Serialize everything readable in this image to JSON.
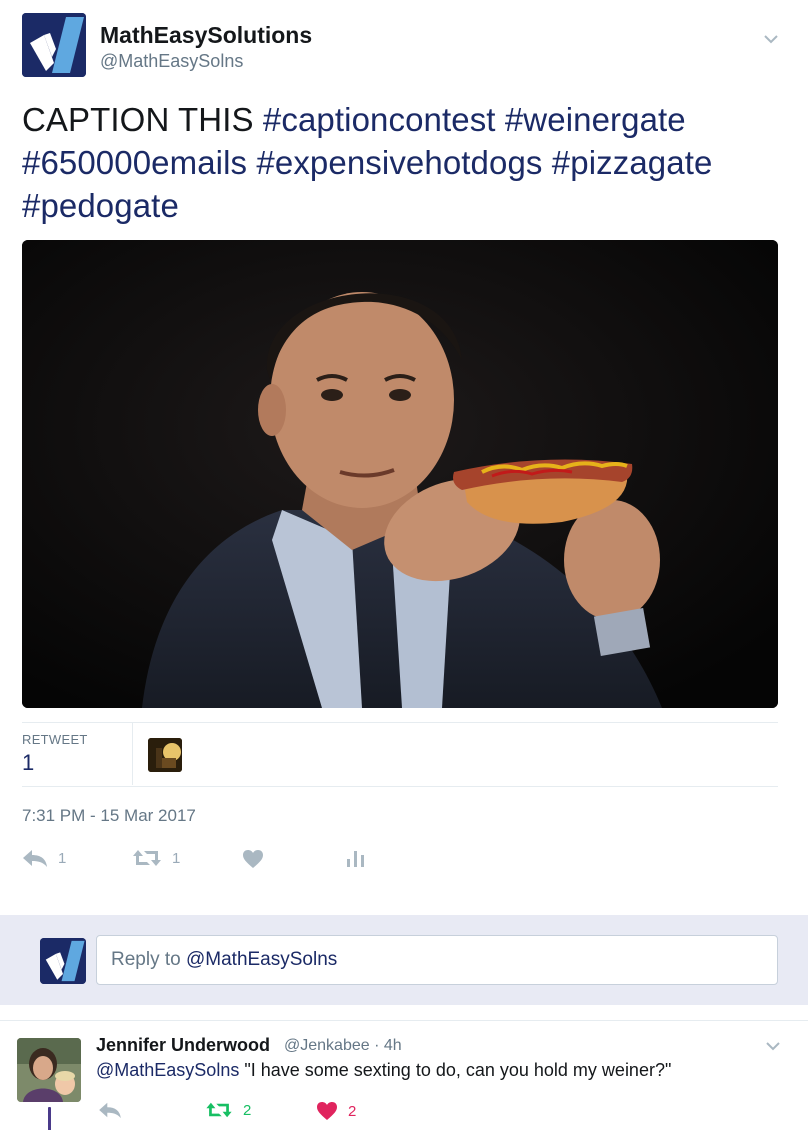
{
  "author": {
    "display_name": "MathEasySolutions",
    "handle": "@MathEasySolns",
    "avatar_icon": "mathesy-logo-icon",
    "brand_color": "#1b2a66",
    "accent_color": "#5fa8e0"
  },
  "tweet": {
    "plain_text": "CAPTION THIS",
    "hashtags": [
      "#captioncontest",
      "#weinergate",
      "#650000emails",
      "#expensivehotdogs",
      "#pizzagate",
      "#pedogate"
    ],
    "retweet_label": "RETWEET",
    "retweet_count": "1",
    "timestamp": "7:31 PM - 15 Mar 2017",
    "actions": {
      "reply_count": "1",
      "retweet_count": "1",
      "like_count": "",
      "analytics_icon": "analytics-icon"
    }
  },
  "reply_box": {
    "prefix": "Reply to ",
    "mention": "@MathEasySolns"
  },
  "reply": {
    "name": "Jennifer Underwood",
    "handle_time": "@Jenkabee · 4h",
    "mention": "@MathEasySolns",
    "text": " \"I have some sexting to do, can you hold my weiner?\"",
    "retweet_count": "2",
    "like_count": "2",
    "retweet_color": "#17bf63",
    "like_color": "#e0245e"
  }
}
